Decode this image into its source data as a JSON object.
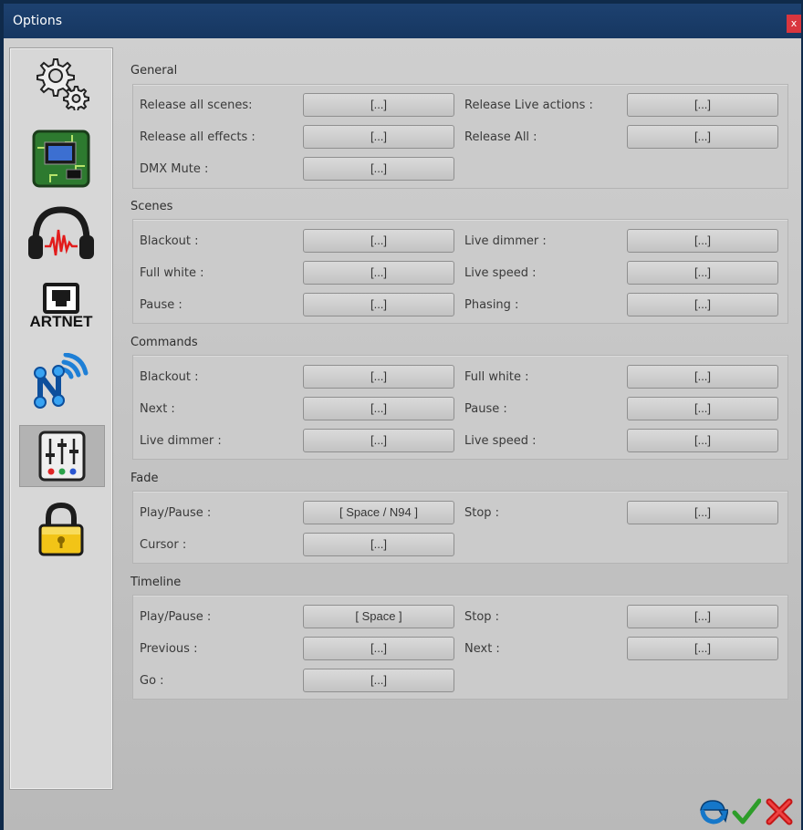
{
  "window": {
    "title": "Options",
    "close_glyph": "x"
  },
  "sidebar": {
    "items": [
      {
        "icon": "gears-icon"
      },
      {
        "icon": "circuit-board-icon"
      },
      {
        "icon": "headphones-audio-icon"
      },
      {
        "icon": "artnet-icon",
        "label": "ARTNET"
      },
      {
        "icon": "wireless-network-icon"
      },
      {
        "icon": "mixer-sliders-icon",
        "selected": true
      },
      {
        "icon": "padlock-icon"
      }
    ]
  },
  "sections": {
    "general": {
      "title": "General",
      "rows": [
        {
          "left_label": "Release all scenes:",
          "left_value": "[...]",
          "right_label": "Release Live actions :",
          "right_value": "[...]"
        },
        {
          "left_label": "Release all effects :",
          "left_value": "[...]",
          "right_label": "Release All :",
          "right_value": "[...]"
        },
        {
          "left_label": "DMX Mute :",
          "left_value": "[...]"
        }
      ]
    },
    "scenes": {
      "title": "Scenes",
      "rows": [
        {
          "left_label": "Blackout :",
          "left_value": "[...]",
          "right_label": "Live dimmer :",
          "right_value": "[...]"
        },
        {
          "left_label": "Full white :",
          "left_value": "[...]",
          "right_label": "Live speed :",
          "right_value": "[...]"
        },
        {
          "left_label": "Pause :",
          "left_value": "[...]",
          "right_label": "Phasing :",
          "right_value": "[...]"
        }
      ]
    },
    "commands": {
      "title": "Commands",
      "rows": [
        {
          "left_label": "Blackout :",
          "left_value": "[...]",
          "right_label": "Full white :",
          "right_value": "[...]"
        },
        {
          "left_label": "Next :",
          "left_value": "[...]",
          "right_label": "Pause :",
          "right_value": "[...]"
        },
        {
          "left_label": "Live dimmer :",
          "left_value": "[...]",
          "right_label": "Live speed :",
          "right_value": "[...]"
        }
      ]
    },
    "fade": {
      "title": "Fade",
      "rows": [
        {
          "left_label": "Play/Pause :",
          "left_value": "[ Space / N94 ]",
          "right_label": "Stop :",
          "right_value": "[...]"
        },
        {
          "left_label": "Cursor :",
          "left_value": "[...]"
        }
      ]
    },
    "timeline": {
      "title": "Timeline",
      "rows": [
        {
          "left_label": "Play/Pause :",
          "left_value": "[ Space ]",
          "right_label": "Stop :",
          "right_value": "[...]"
        },
        {
          "left_label": "Previous :",
          "left_value": "[...]",
          "right_label": "Next :",
          "right_value": "[...]"
        },
        {
          "left_label": "Go :",
          "left_value": "[...]"
        }
      ]
    }
  },
  "footer": {
    "icons": [
      "reset-icon",
      "confirm-check-icon",
      "cancel-x-icon"
    ]
  }
}
